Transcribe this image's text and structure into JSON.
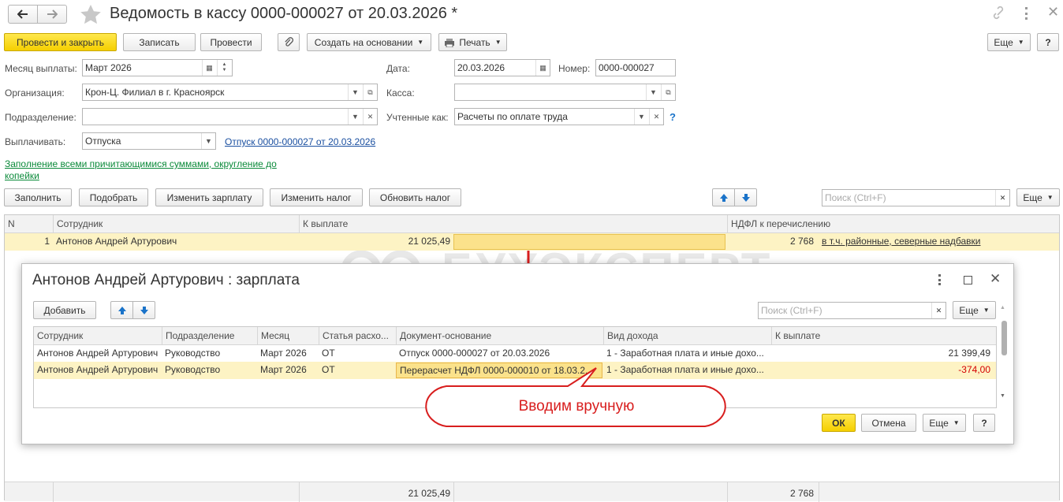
{
  "window": {
    "title": "Ведомость в кассу 0000-000027 от 20.03.2026 *"
  },
  "toolbar": {
    "post_close": "Провести и закрыть",
    "save": "Записать",
    "post": "Провести",
    "create_based": "Создать на основании",
    "print": "Печать",
    "more": "Еще",
    "help": "?"
  },
  "form": {
    "month_label": "Месяц выплаты:",
    "month_value": "Март 2026",
    "date_label": "Дата:",
    "date_value": "20.03.2026",
    "number_label": "Номер:",
    "number_value": "0000-000027",
    "org_label": "Организация:",
    "org_value": "Крон-Ц. Филиал в г. Красноярск",
    "cash_label": "Касса:",
    "cash_value": "",
    "dept_label": "Подразделение:",
    "dept_value": "",
    "accounted_label": "Учтенные как:",
    "accounted_value": "Расчеты по оплате труда",
    "accounted_help": "?",
    "pay_label": "Выплачивать:",
    "pay_value": "Отпуска",
    "pay_link": "Отпуск 0000-000027 от 20.03.2026",
    "fill_link_1": "Заполнение всеми причитающимися суммами, округление до",
    "fill_link_2": "копейки"
  },
  "table_toolbar": {
    "fill": "Заполнить",
    "pick": "Подобрать",
    "change_salary": "Изменить зарплату",
    "change_tax": "Изменить налог",
    "refresh_tax": "Обновить налог",
    "search_placeholder": "Поиск (Ctrl+F)",
    "more": "Еще"
  },
  "main_table": {
    "headers": [
      "N",
      "Сотрудник",
      "К выплате",
      "НДФЛ к перечислению"
    ],
    "rows": [
      {
        "n": "1",
        "employee": "Антонов Андрей Артурович",
        "to_pay": "21 025,49",
        "ndfl": "2 768",
        "ndfl_link": "в т.ч. районные, северные надбавки"
      }
    ],
    "totals": {
      "to_pay": "21 025,49",
      "ndfl": "2 768"
    }
  },
  "watermark": "БУХЭКСПЕРТ",
  "dialog": {
    "title": "Антонов Андрей Артурович : зарплата",
    "add": "Добавить",
    "search_placeholder": "Поиск (Ctrl+F)",
    "more": "Еще",
    "headers": [
      "Сотрудник",
      "Подразделение",
      "Месяц",
      "Статья расхо...",
      "Документ-основание",
      "Вид дохода",
      "К выплате"
    ],
    "rows": [
      [
        "Антонов Андрей Артурович",
        "Руководство",
        "Март 2026",
        "ОТ",
        "Отпуск 0000-000027 от 20.03.2026",
        "1 - Заработная плата и иные дохо...",
        "21 399,49"
      ],
      [
        "Антонов Андрей Артурович",
        "Руководство",
        "Март 2026",
        "ОТ",
        "Перерасчет НДФЛ 0000-000010 от 18.03.2...",
        "1 - Заработная плата и иные дохо...",
        "-374,00"
      ]
    ],
    "ok": "ОК",
    "cancel": "Отмена",
    "more2": "Еще",
    "help": "?"
  },
  "callout": {
    "text": "Вводим вручную"
  },
  "colors": {
    "accent_yellow": "#f5cf00",
    "row_highlight": "#fdf3c4",
    "link_blue": "#1a4fa0",
    "link_green": "#0b8a3a",
    "callout_red": "#d81e1e",
    "negative": "#d40000"
  }
}
